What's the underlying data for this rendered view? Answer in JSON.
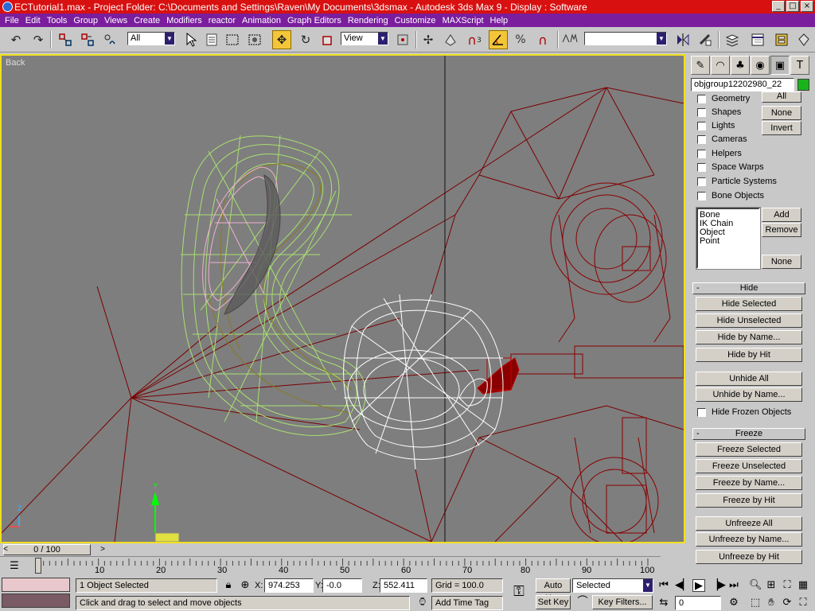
{
  "window": {
    "title": "ECTutorial1.max     - Project Folder: C:\\Documents and Settings\\Raven\\My Documents\\3dsmax    - Autodesk 3ds Max 9      - Display : Software",
    "controls": [
      "_",
      "□",
      "×"
    ]
  },
  "menu": [
    "File",
    "Edit",
    "Tools",
    "Group",
    "Views",
    "Create",
    "Modifiers",
    "reactor",
    "Animation",
    "Graph Editors",
    "Rendering",
    "Customize",
    "MAXScript",
    "Help"
  ],
  "toolbar": {
    "selection_filter": "All",
    "reference_coord": "View",
    "named_selection": "",
    "snap_label": "3",
    "colors": {
      "active": "#f3c63a"
    }
  },
  "viewport": {
    "label": "Back",
    "colors": {
      "background": "#7e7e7e",
      "border": "#f0e020",
      "green_mesh": "#a8e070",
      "pink_mesh": "#f0b0d0",
      "white_mesh": "#ffffff",
      "red_mesh": "#8a0000",
      "bone_line": "#7a0000"
    },
    "axis": {
      "y": "Y",
      "z": "Z"
    }
  },
  "command_panel": {
    "tabs": [
      "create-icon",
      "modify-icon",
      "hierarchy-icon",
      "motion-icon",
      "display-icon",
      "utilities-icon"
    ],
    "object_name": "objgroup12202980_22",
    "object_color": "#1ab31a",
    "hide_by_category": {
      "items": [
        "Geometry",
        "Shapes",
        "Lights",
        "Cameras",
        "Helpers",
        "Space Warps",
        "Particle Systems",
        "Bone Objects"
      ],
      "all_label": "All",
      "none_label": "None",
      "invert_label": "Invert",
      "list": [
        "Bone",
        "IK Chain Object",
        "Point"
      ],
      "add_label": "Add",
      "remove_label": "Remove",
      "list_none_label": "None"
    },
    "hide": {
      "title": "Hide",
      "buttons": [
        "Hide Selected",
        "Hide Unselected",
        "Hide by Name...",
        "Hide by Hit"
      ],
      "unhide_buttons": [
        "Unhide All",
        "Unhide by Name..."
      ],
      "hide_frozen": "Hide Frozen Objects"
    },
    "freeze": {
      "title": "Freeze",
      "buttons": [
        "Freeze Selected",
        "Freeze Unselected",
        "Freeze by Name...",
        "Freeze by Hit"
      ],
      "unfreeze_buttons": [
        "Unfreeze All",
        "Unfreeze by Name...",
        "Unfreeze by Hit"
      ]
    },
    "rollout_minus": "-"
  },
  "timeline": {
    "slider_label": "0 / 100",
    "prev_arrow": "<",
    "next_arrow": ">",
    "ticks": [
      "0",
      "10",
      "20",
      "30",
      "40",
      "50",
      "60",
      "70",
      "80",
      "90",
      "100"
    ]
  },
  "status": {
    "selected": "1 Object Selected",
    "prompt": "Click and drag to select and move objects",
    "x_label": "X:",
    "x_value": "974.253",
    "y_label": "Y:",
    "y_value": "-0.0",
    "z_label": "Z:",
    "z_value": "552.411",
    "grid": "Grid = 100.0",
    "add_time_tag": "Add Time Tag",
    "auto_key": "Auto Key",
    "set_key": "Set Key",
    "key_mode": "Selected",
    "key_filters": "Key Filters...",
    "frame": "0"
  }
}
